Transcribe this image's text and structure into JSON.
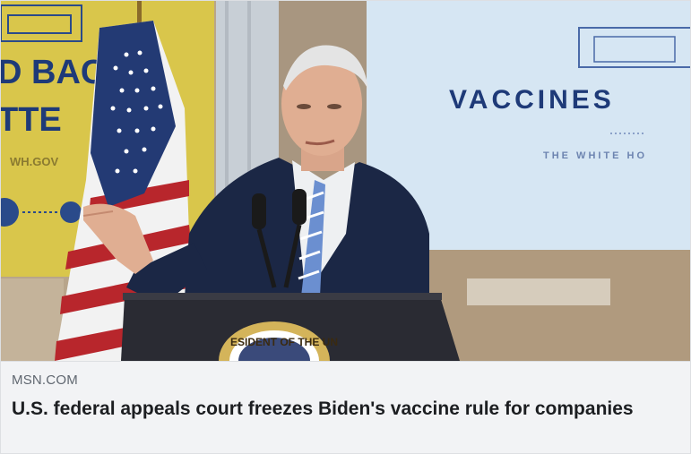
{
  "link_preview": {
    "domain": "MSN.COM",
    "headline": "U.S. federal appeals court freezes Biden's vaccine rule for companies"
  },
  "image": {
    "left_banner_text": [
      "D BACK",
      "TTE",
      "WH.GOV"
    ],
    "right_screen_text": [
      "VACCINES",
      "THE WHITE HO"
    ],
    "seal_text": "ESIDENT OF THE UN",
    "colors": {
      "banner_yellow": "#d8c54a",
      "screen_blue": "#d9e8f4",
      "navy_text": "#1e3a78",
      "suit_navy": "#1a2744",
      "footer_bg": "#f2f3f5"
    }
  }
}
